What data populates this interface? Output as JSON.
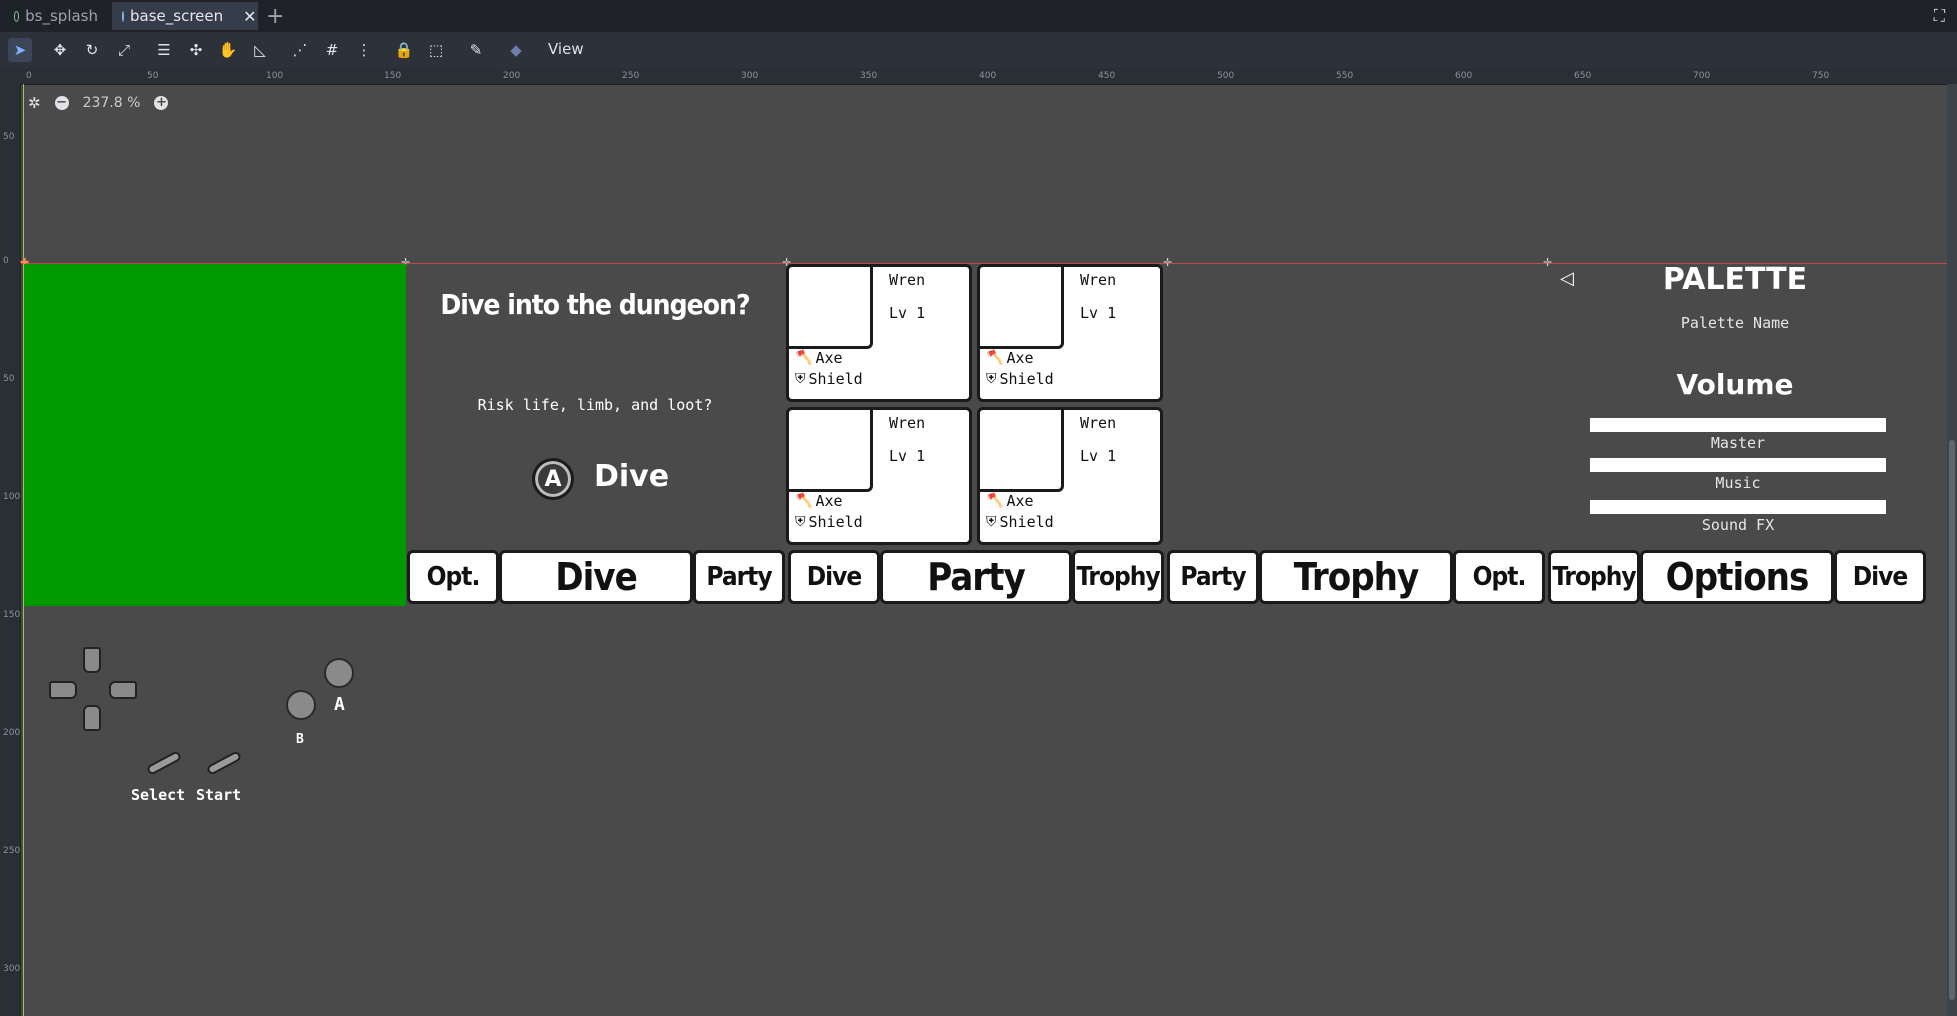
{
  "tabs": [
    {
      "label": "bs_splash",
      "active": false
    },
    {
      "label": "base_screen",
      "active": true
    }
  ],
  "toolbar": {
    "view_label": "View",
    "icons": [
      "select-icon",
      "move-icon",
      "rotate-icon",
      "scale-icon",
      "list-select-icon",
      "pivot-icon",
      "pan-icon",
      "ruler-icon",
      "smart-snap-icon",
      "grid-snap-icon",
      "more-options-icon",
      "lock-icon",
      "group-icon",
      "bone-icon",
      "skeleton-icon"
    ]
  },
  "ruler": {
    "top_ticks": [
      "0",
      "50",
      "100",
      "150",
      "200",
      "250",
      "300",
      "350",
      "400",
      "450",
      "500",
      "550",
      "600",
      "650",
      "700",
      "750"
    ],
    "left_ticks": [
      "50",
      "0",
      "50",
      "100",
      "150",
      "200",
      "250",
      "300"
    ]
  },
  "canvas": {
    "zoom_label": "237.8 %"
  },
  "dungeon_prompt": {
    "title": "Dive into the dungeon?",
    "subtitle": "Risk life, limb, and loot?",
    "button_glyph": "A",
    "action_label": "Dive"
  },
  "party_cards": [
    {
      "name": "Wren",
      "level": "Lv 1",
      "weapon": "Axe",
      "armor": "Shield"
    },
    {
      "name": "Wren",
      "level": "Lv 1",
      "weapon": "Axe",
      "armor": "Shield"
    },
    {
      "name": "Wren",
      "level": "Lv 1",
      "weapon": "Axe",
      "armor": "Shield"
    },
    {
      "name": "Wren",
      "level": "Lv 1",
      "weapon": "Axe",
      "armor": "Shield"
    }
  ],
  "settings": {
    "palette_title": "PALETTE",
    "palette_name": "Palette Name",
    "volume_title": "Volume",
    "sliders": [
      {
        "label": "Master",
        "level": 1.0
      },
      {
        "label": "Music",
        "level": 1.0
      },
      {
        "label": "Sound FX",
        "level": 1.0
      }
    ]
  },
  "nav_buttons": [
    "Opt.",
    "Dive",
    "Party",
    "Dive",
    "Party",
    "Trophy",
    "Party",
    "Trophy",
    "Opt.",
    "Trophy",
    "Options",
    "Dive"
  ],
  "gamepad": {
    "a_label": "A",
    "b_label": "B",
    "select_label": "Select",
    "start_label": "Start"
  },
  "colors": {
    "canvas_bg": "#4a4a4a",
    "green_rect": "#009a00",
    "guide_line": "#c0474a",
    "ui_white": "#ffffff"
  }
}
